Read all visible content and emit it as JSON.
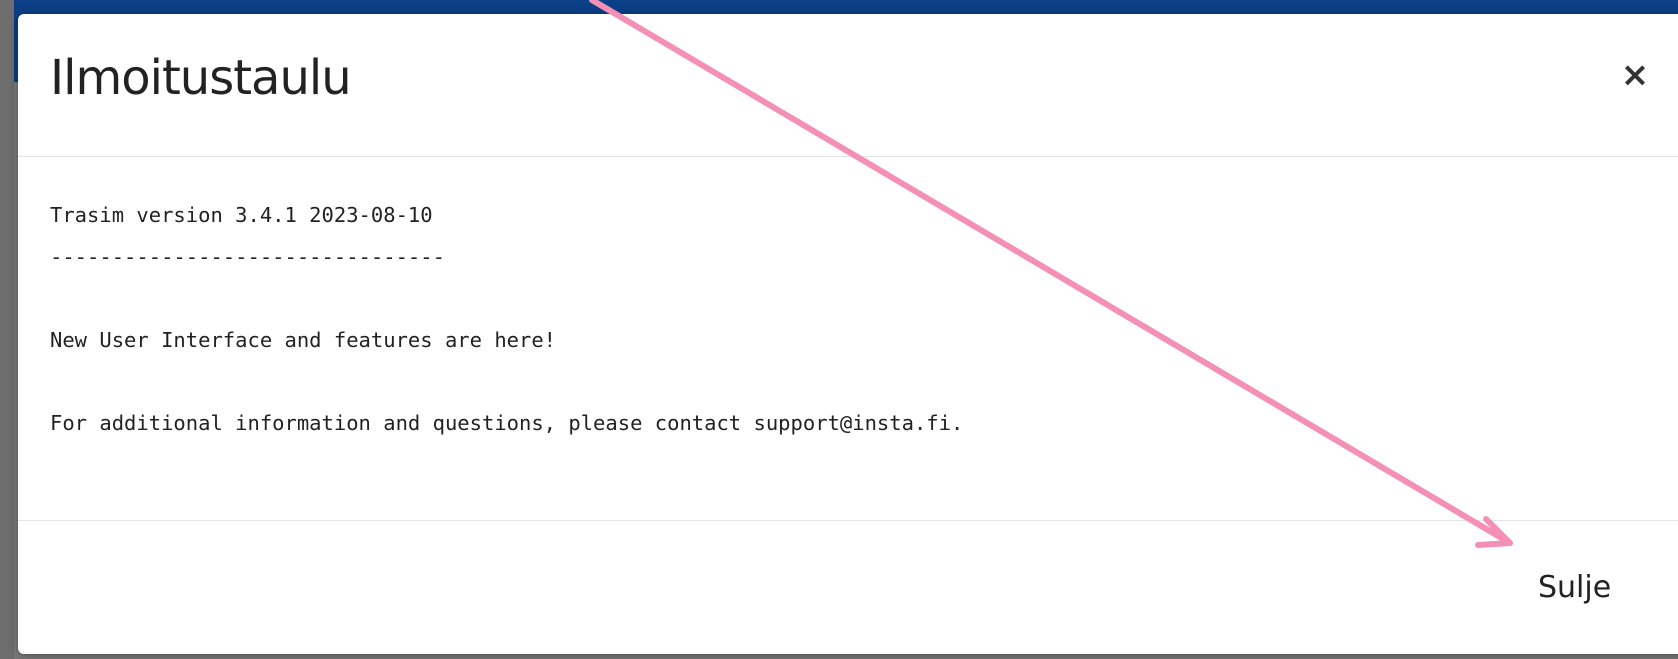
{
  "modal": {
    "title": "Ilmoitustaulu",
    "close_icon": "close-icon",
    "close_glyph": "×",
    "body_lines": [
      "Trasim version 3.4.1 2023-08-10",
      "--------------------------------",
      "",
      "New User Interface and features are here!",
      "",
      "For additional information and questions, please contact support@insta.fi."
    ],
    "footer": {
      "close_label": "Sulje"
    }
  },
  "colors": {
    "header_bar": "#0b3f86",
    "backdrop": "#7b7b7b",
    "annotation_arrow": "#f48fb5"
  }
}
